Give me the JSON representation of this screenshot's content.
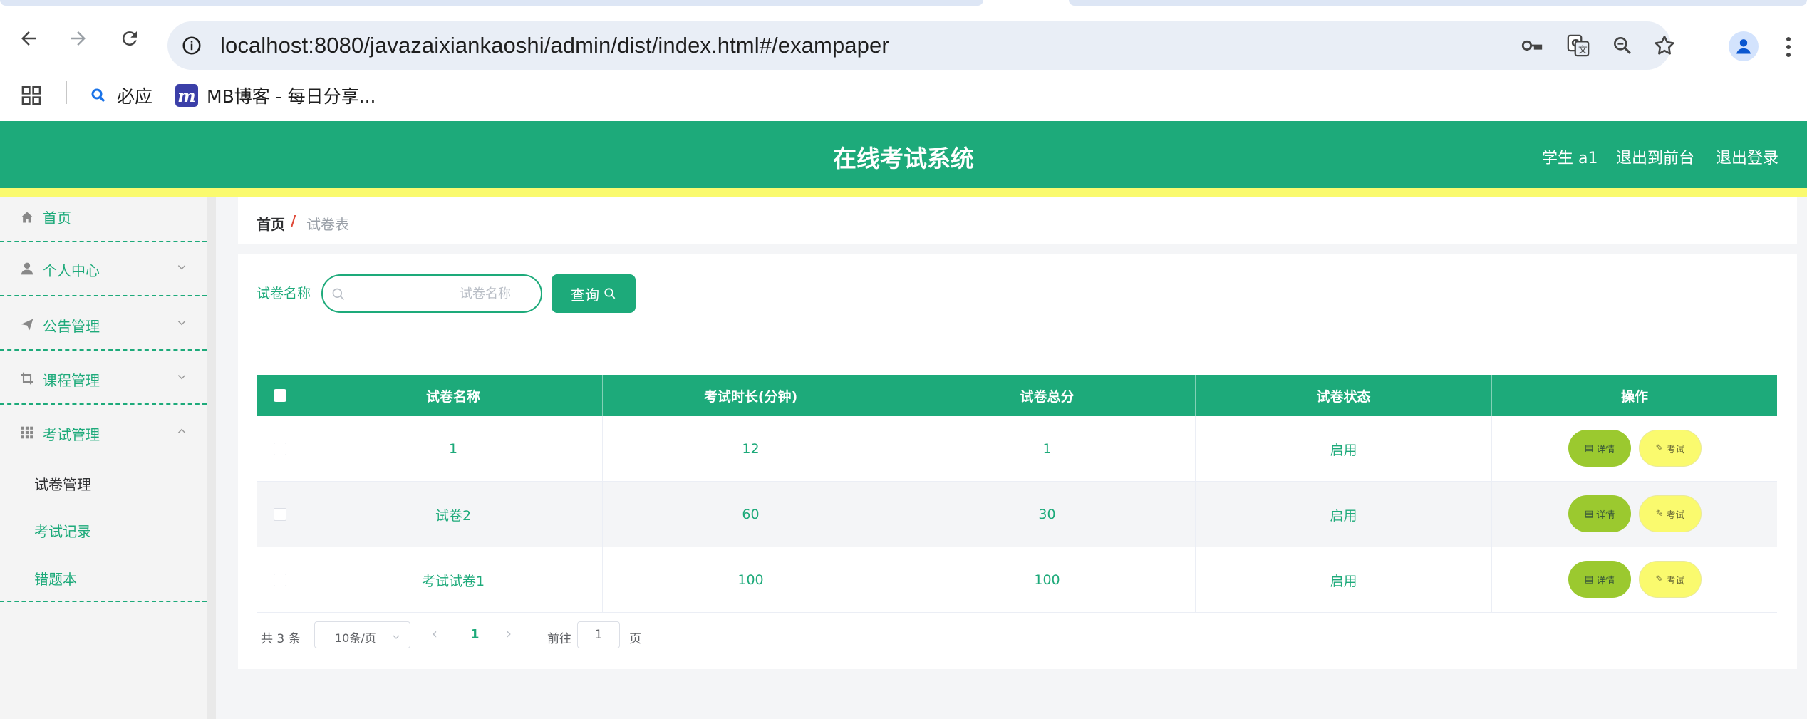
{
  "browser": {
    "url": "localhost:8080/javazaixiankaoshi/admin/dist/index.html#/exampaper",
    "bookmarks": [
      {
        "label": "必应"
      },
      {
        "label": "MB博客 - 每日分享..."
      }
    ]
  },
  "header": {
    "title": "在线考试系统",
    "links": [
      "学生 a1",
      "退出到前台",
      "退出登录"
    ]
  },
  "sidebar": {
    "items": [
      {
        "label": "首页",
        "icon": "home-icon"
      },
      {
        "label": "个人中心",
        "icon": "user-icon"
      },
      {
        "label": "公告管理",
        "icon": "send-icon"
      },
      {
        "label": "课程管理",
        "icon": "crop-icon"
      },
      {
        "label": "考试管理",
        "icon": "grid-icon"
      }
    ],
    "subitems": [
      {
        "label": "试卷管理",
        "active": true
      },
      {
        "label": "考试记录",
        "active": false
      },
      {
        "label": "错题本",
        "active": false
      }
    ]
  },
  "breadcrumb": {
    "home": "首页",
    "separator": "/",
    "current": "试卷表"
  },
  "search": {
    "label": "试卷名称",
    "placeholder": "试卷名称",
    "button": "查询"
  },
  "table": {
    "columns": [
      "试卷名称",
      "考试时长(分钟)",
      "试卷总分",
      "试卷状态",
      "操作"
    ],
    "rows": [
      {
        "name": "1",
        "duration": "12",
        "score": "1",
        "status": "启用"
      },
      {
        "name": "试卷2",
        "duration": "60",
        "score": "30",
        "status": "启用"
      },
      {
        "name": "考试试卷1",
        "duration": "100",
        "score": "100",
        "status": "启用"
      }
    ],
    "action_detail": "详情",
    "action_exam": "考试"
  },
  "pagination": {
    "total": "共 3 条",
    "page_size": "10条/页",
    "current_page": "1",
    "goto_label": "前往",
    "goto_value": "1",
    "page_suffix": "页"
  },
  "colors": {
    "primary": "#1daa7a",
    "accent_yellow": "#fafa6e",
    "detail_green": "#9bc92f"
  }
}
